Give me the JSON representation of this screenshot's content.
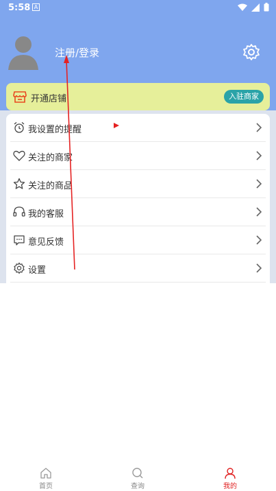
{
  "status": {
    "time": "5:58",
    "notification_badge": "A"
  },
  "profile": {
    "login_label": "注册/登录"
  },
  "store": {
    "label": "开通店铺",
    "join_label": "入驻商家"
  },
  "menu": {
    "items": [
      {
        "label": "我设置的提醒",
        "icon": "alarm-clock-icon"
      },
      {
        "label": "关注的商家",
        "icon": "heart-icon"
      },
      {
        "label": "关注的商品",
        "icon": "star-icon"
      },
      {
        "label": "我的客服",
        "icon": "headset-icon"
      },
      {
        "label": "意见反馈",
        "icon": "feedback-icon"
      },
      {
        "label": "设置",
        "icon": "gear-icon"
      }
    ]
  },
  "tabbar": {
    "tabs": [
      {
        "label": "首页",
        "icon": "home-icon",
        "active": false
      },
      {
        "label": "查询",
        "icon": "search-icon",
        "active": false
      },
      {
        "label": "我的",
        "icon": "user-icon",
        "active": true
      }
    ]
  },
  "colors": {
    "header": "#7fa6ee",
    "store_bar": "#e6ef9a",
    "join_button": "#2aa3a8",
    "active_tab": "#e02020",
    "annotation": "#e52222"
  }
}
